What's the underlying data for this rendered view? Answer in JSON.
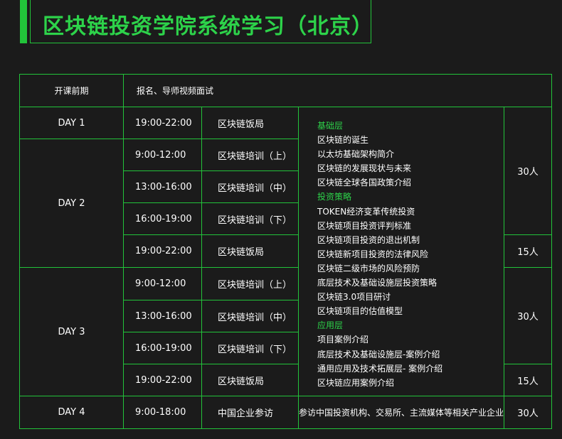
{
  "title": "区块链投资学院系统学习（北京）",
  "colors": {
    "accent": "#22c33a",
    "background": "#1b1b1b",
    "text": "#ffffff"
  },
  "header": {
    "label": "开课前期",
    "value": "报名、导师视频面试"
  },
  "days": {
    "day1": "DAY 1",
    "day2": "DAY 2",
    "day3": "DAY 3",
    "day4": "DAY 4"
  },
  "rows": [
    {
      "time": "19:00-22:00",
      "activity": "区块链饭局"
    },
    {
      "time": "9:00-12:00",
      "activity": "区块链培训（上）"
    },
    {
      "time": "13:00-16:00",
      "activity": "区块链培训（中）"
    },
    {
      "time": "16:00-19:00",
      "activity": "区块链培训（下）"
    },
    {
      "time": "19:00-22:00",
      "activity": "区块链饭局"
    },
    {
      "time": "9:00-12:00",
      "activity": "区块链培训（上）"
    },
    {
      "time": "13:00-16:00",
      "activity": "区块链培训（中）"
    },
    {
      "time": "16:00-19:00",
      "activity": "区块链培训（下）"
    },
    {
      "time": "19:00-22:00",
      "activity": "区块链饭局"
    },
    {
      "time": "9:00-18:00",
      "activity": "中国企业参访"
    }
  ],
  "counts": {
    "a": "30人",
    "b": "15人",
    "c": "30人",
    "d": "15人",
    "e": "30人"
  },
  "day4_note": "参访中国投资机构、交易所、主流媒体等相关产业企业",
  "topics": [
    {
      "text": "基础层",
      "category": true
    },
    {
      "text": "区块链的诞生",
      "category": false
    },
    {
      "text": "以太坊基础架构简介",
      "category": false
    },
    {
      "text": "区块链的发展现状与未来",
      "category": false
    },
    {
      "text": "区块链全球各国政策介绍",
      "category": false
    },
    {
      "text": "投资策略",
      "category": true
    },
    {
      "text": "TOKEN经济变革传统投资",
      "category": false
    },
    {
      "text": "区块链项目投资评判标准",
      "category": false
    },
    {
      "text": "区块链项目投资的退出机制",
      "category": false
    },
    {
      "text": "区块链新项目投资的法律风险",
      "category": false
    },
    {
      "text": "区块链二级市场的风险预防",
      "category": false
    },
    {
      "text": "底层技术及基础设施层投资策略",
      "category": false
    },
    {
      "text": "区块链3.0项目研讨",
      "category": false
    },
    {
      "text": "区块链项目的估值模型",
      "category": false
    },
    {
      "text": "应用层",
      "category": true
    },
    {
      "text": "项目案例介绍",
      "category": false
    },
    {
      "text": "底层技术及基础设施层-案例介绍",
      "category": false
    },
    {
      "text": "通用应用及技术拓展层- 案例介绍",
      "category": false
    },
    {
      "text": "区块链应用案例介绍",
      "category": false
    }
  ]
}
